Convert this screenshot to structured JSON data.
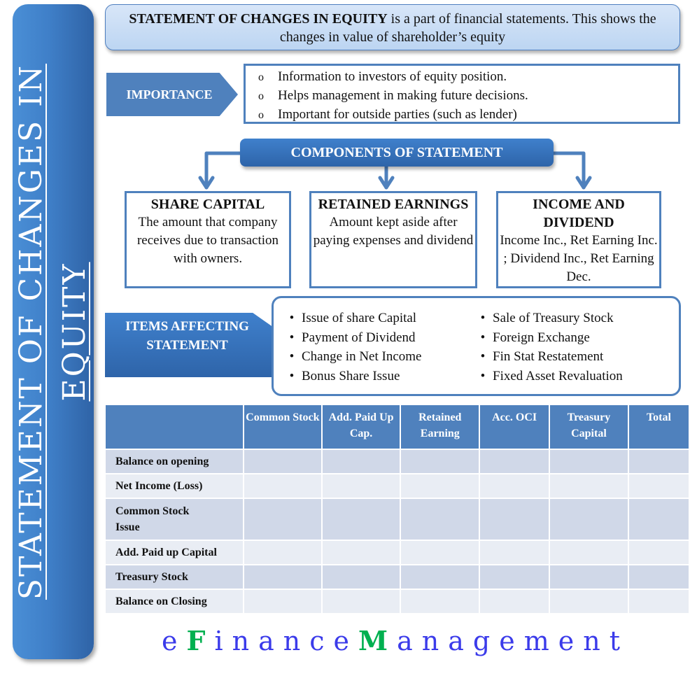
{
  "side_banner": {
    "line1": "STATEMENT OF CHANGES IN",
    "line2": "EQUITY"
  },
  "definition": {
    "bold": "STATEMENT  OF CHANGES IN EQUITY",
    "rest": " is a part of financial statements. This shows the changes in value of shareholder’s equity"
  },
  "importance": {
    "label": "IMPORTANCE",
    "bullet": "o",
    "items": [
      "Information to investors of equity position.",
      "Helps management in making future decisions.",
      "Important for outside parties (such as lender)"
    ]
  },
  "components": {
    "title": "COMPONENTS OF STATEMENT",
    "boxes": [
      {
        "title": "SHARE CAPITAL",
        "text": "The amount that company receives due to transaction with owners."
      },
      {
        "title": "RETAINED EARNINGS",
        "text": "Amount kept aside after paying expenses and dividend"
      },
      {
        "title": "INCOME AND DIVIDEND",
        "text": "Income Inc., Ret Earning Inc. ; Dividend Inc., Ret Earning Dec."
      }
    ]
  },
  "items_affecting": {
    "label": "ITEMS AFFECTING STATEMENT",
    "bullet": "•",
    "col1": [
      "Issue of share Capital",
      "Payment of Dividend",
      "Change in Net Income",
      "Bonus Share Issue"
    ],
    "col2": [
      "Sale of Treasury Stock",
      "Foreign Exchange",
      "Fin Stat Restatement",
      "Fixed Asset Revaluation"
    ]
  },
  "table": {
    "headers": [
      "",
      "Common Stock",
      "Add. Paid Up Cap.",
      "Retained Earning",
      "Acc. OCI",
      "Treasury Capital",
      "Total"
    ],
    "rows": [
      "Balance on opening",
      "Net Income (Loss)",
      "Common Stock Issue",
      "Add. Paid up Capital",
      "Treasury Stock",
      "Balance on Closing"
    ]
  },
  "brand": {
    "e": "e",
    "F": "F",
    "inance": "inance",
    "M": "M",
    "anagement": "anagement"
  },
  "colors": {
    "primary_blue": "#4f81bd",
    "brand_blue": "#3b3bea",
    "brand_green": "#00b050"
  }
}
